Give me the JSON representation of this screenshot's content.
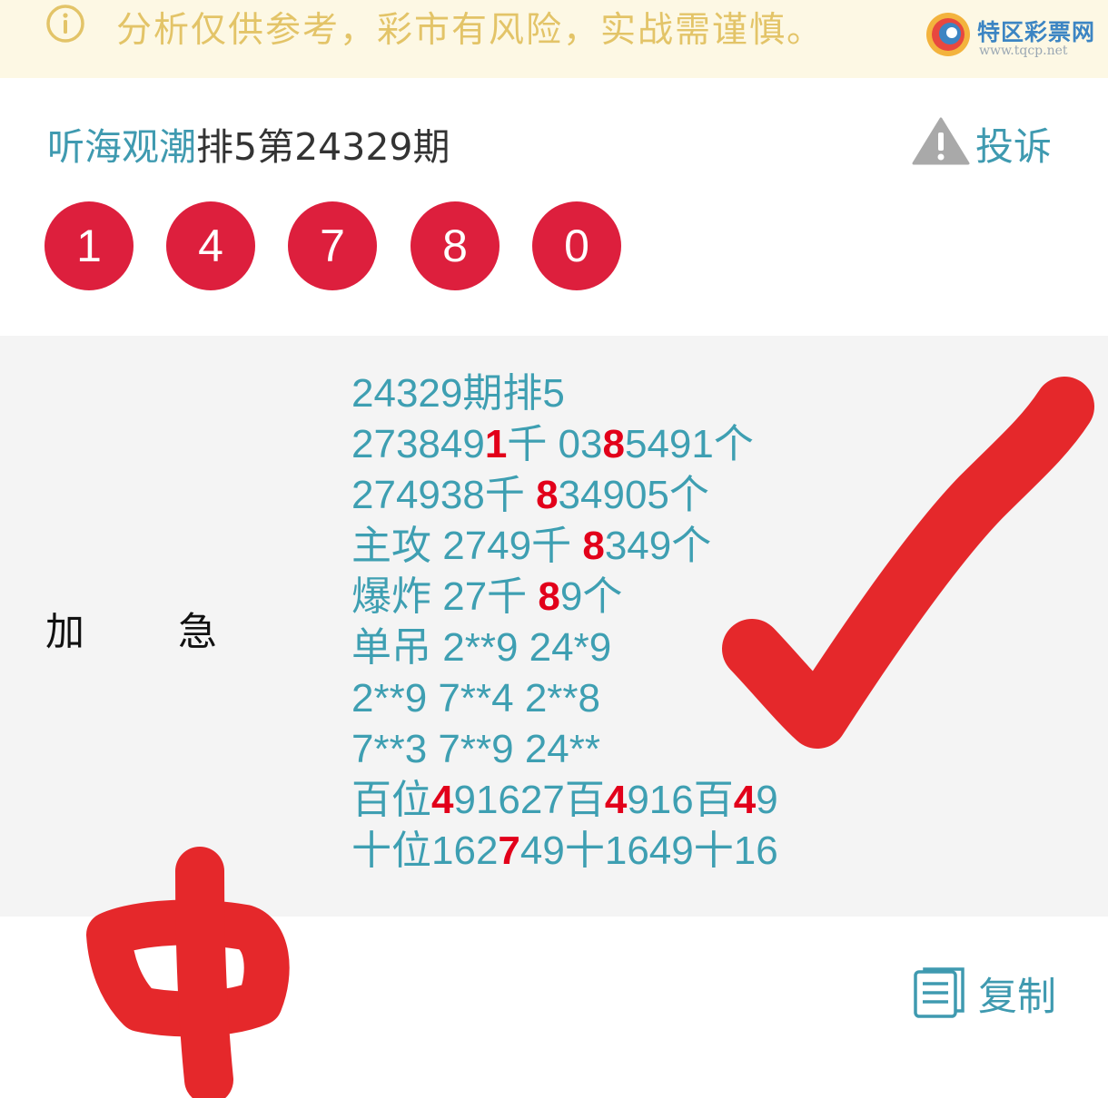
{
  "notice": {
    "text": "分析仅供参考，彩市有风险，实战需谨慎。",
    "icon": "info-icon"
  },
  "logo": {
    "name": "特区彩票网",
    "url": "www.tqcp.net"
  },
  "post": {
    "author": "听海观潮",
    "title_rest": "排5第24329期",
    "report_label": "投诉",
    "numbers": [
      "1",
      "4",
      "7",
      "8",
      "0"
    ]
  },
  "labels": {
    "left": "加",
    "right": "急"
  },
  "lines": [
    [
      {
        "t": "24329期排5",
        "h": false
      }
    ],
    [
      {
        "t": "273849",
        "h": false
      },
      {
        "t": "1",
        "h": true
      },
      {
        "t": "千 03",
        "h": false
      },
      {
        "t": "8",
        "h": true
      },
      {
        "t": "5491个",
        "h": false
      }
    ],
    [
      {
        "t": "274938千 ",
        "h": false
      },
      {
        "t": "8",
        "h": true
      },
      {
        "t": "34905个",
        "h": false
      }
    ],
    [
      {
        "t": "主攻 2749千 ",
        "h": false
      },
      {
        "t": "8",
        "h": true
      },
      {
        "t": "349个",
        "h": false
      }
    ],
    [
      {
        "t": "爆炸 27千 ",
        "h": false
      },
      {
        "t": "8",
        "h": true
      },
      {
        "t": "9个",
        "h": false
      }
    ],
    [
      {
        "t": "单吊 2**9 24*9",
        "h": false
      }
    ],
    [
      {
        "t": "2**9 7**4 2**8",
        "h": false
      }
    ],
    [
      {
        "t": "7**3 7**9 24**",
        "h": false
      }
    ],
    [
      {
        "t": "百位",
        "h": false
      },
      {
        "t": "4",
        "h": true
      },
      {
        "t": "91627百",
        "h": false
      },
      {
        "t": "4",
        "h": true
      },
      {
        "t": "916百",
        "h": false
      },
      {
        "t": "4",
        "h": true
      },
      {
        "t": "9",
        "h": false
      }
    ],
    [
      {
        "t": "十位162",
        "h": false
      },
      {
        "t": "7",
        "h": true
      },
      {
        "t": "49十1649十16",
        "h": false
      }
    ]
  ],
  "copy_label": "复制",
  "colors": {
    "ball": "#dd1f3d",
    "accent": "#3f9ab0",
    "highlight": "#e2001a",
    "notice_text": "#e3c468"
  }
}
